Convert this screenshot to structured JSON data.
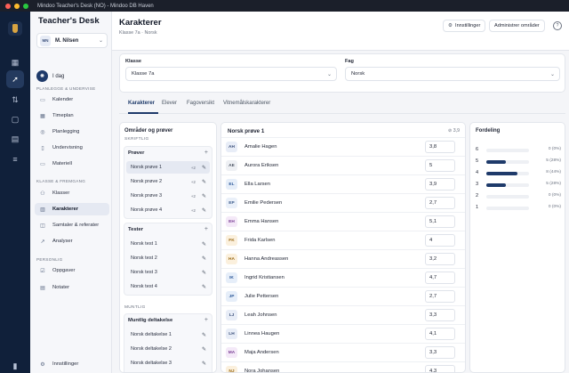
{
  "window": {
    "title": "Mindoo Teacher's Desk (NO) - Mindoo DB Haven"
  },
  "brand": {
    "name": "Teacher's Desk"
  },
  "user": {
    "initials": "MN",
    "name": "M. Nilsen"
  },
  "today": {
    "label": "I dag"
  },
  "sidebar": {
    "section1": "PLANLEGGE & UNDERVISE",
    "section2": "KLASSE & FREMGANG",
    "section3": "PERSONLIG",
    "items1": [
      {
        "label": "Kalender"
      },
      {
        "label": "Timeplan"
      },
      {
        "label": "Planlegging"
      },
      {
        "label": "Undervisning"
      },
      {
        "label": "Materiell"
      }
    ],
    "items2": [
      {
        "label": "Klasser"
      },
      {
        "label": "Karakterer"
      },
      {
        "label": "Samtaler & referater"
      },
      {
        "label": "Analyser"
      }
    ],
    "items3": [
      {
        "label": "Oppgaver"
      },
      {
        "label": "Notater"
      }
    ],
    "settings": "Innstillinger"
  },
  "header": {
    "title": "Karakterer",
    "breadcrumb": "Klasse 7a · Norsk",
    "settings_label": "Innstillinger",
    "manage_label": "Administrer områder",
    "help": "?"
  },
  "filters": {
    "class_label": "Klasse",
    "class_value": "Klasse 7a",
    "subject_label": "Fag",
    "subject_value": "Norsk"
  },
  "tabs": [
    {
      "label": "Karakterer"
    },
    {
      "label": "Elever"
    },
    {
      "label": "Fagoversikt"
    },
    {
      "label": "Vitnemålskarakterer"
    }
  ],
  "areas": {
    "title": "Områder og prøver",
    "written": "SKRIFTLIG",
    "oral": "MUNTLIG",
    "groups": [
      {
        "name": "Prøver",
        "items": [
          {
            "label": "Norsk prøve 1",
            "badge": "+2"
          },
          {
            "label": "Norsk prøve 2",
            "badge": "+2"
          },
          {
            "label": "Norsk prøve 3",
            "badge": "+2"
          },
          {
            "label": "Norsk prøve 4",
            "badge": "+2"
          }
        ]
      },
      {
        "name": "Tester",
        "items": [
          {
            "label": "Norsk test 1"
          },
          {
            "label": "Norsk test 2"
          },
          {
            "label": "Norsk test 3"
          },
          {
            "label": "Norsk test 4"
          }
        ]
      },
      {
        "name": "Muntlig deltakelse",
        "items": [
          {
            "label": "Norsk deltakelse 1"
          },
          {
            "label": "Norsk deltakelse 2"
          },
          {
            "label": "Norsk deltakelse 3"
          }
        ]
      }
    ]
  },
  "grades": {
    "title": "Norsk prøve 1",
    "average": "3,9",
    "students": [
      {
        "initials": "AH",
        "name": "Amalie Hagen",
        "grade": "3,8"
      },
      {
        "initials": "AE",
        "name": "Aurora Eriksen",
        "grade": "5"
      },
      {
        "initials": "EL",
        "name": "Ella Larsen",
        "grade": "3,9"
      },
      {
        "initials": "EP",
        "name": "Emilie Pedersen",
        "grade": "2,7"
      },
      {
        "initials": "EH",
        "name": "Emma Hansen",
        "grade": "5,1"
      },
      {
        "initials": "FK",
        "name": "Frida Karlsen",
        "grade": "4"
      },
      {
        "initials": "HA",
        "name": "Hanna Andreassen",
        "grade": "3,2"
      },
      {
        "initials": "IK",
        "name": "Ingrid Kristiansen",
        "grade": "4,7"
      },
      {
        "initials": "JP",
        "name": "Julie Pettersen",
        "grade": "2,7"
      },
      {
        "initials": "LJ",
        "name": "Leah Johnsen",
        "grade": "3,3"
      },
      {
        "initials": "LH",
        "name": "Linnea Haugen",
        "grade": "4,1"
      },
      {
        "initials": "MA",
        "name": "Maja Andersen",
        "grade": "3,3"
      },
      {
        "initials": "NJ",
        "name": "Nora Johansen",
        "grade": "4,3"
      }
    ]
  },
  "distribution": {
    "title": "Fordeling",
    "rows": [
      {
        "grade": "6",
        "count": "0 (0%)",
        "fraction": 0
      },
      {
        "grade": "5",
        "count": "5 (28%)",
        "fraction": 0.28
      },
      {
        "grade": "4",
        "count": "8 (44%)",
        "fraction": 0.44
      },
      {
        "grade": "3",
        "count": "5 (28%)",
        "fraction": 0.28
      },
      {
        "grade": "2",
        "count": "0 (0%)",
        "fraction": 0
      },
      {
        "grade": "1",
        "count": "0 (0%)",
        "fraction": 0
      }
    ]
  },
  "colors": {
    "accent": "#1e3a6a",
    "rail": "#10203a"
  }
}
